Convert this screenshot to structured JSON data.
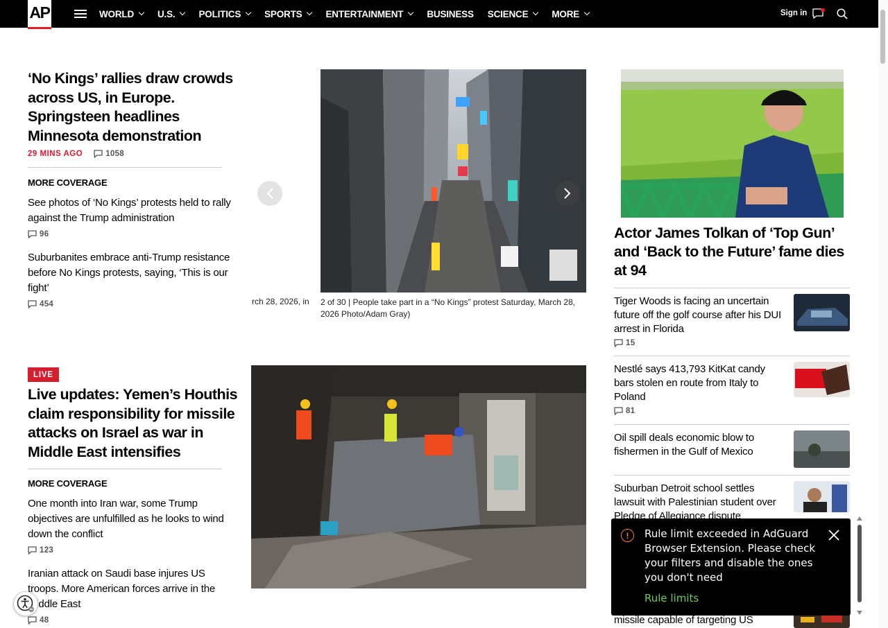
{
  "nav": {
    "logo": "AP",
    "items": [
      "WORLD",
      "U.S.",
      "POLITICS",
      "SPORTS",
      "ENTERTAINMENT",
      "BUSINESS",
      "SCIENCE",
      "MORE"
    ],
    "has_chevron": [
      true,
      true,
      true,
      true,
      true,
      false,
      true,
      true
    ],
    "signin": "Sign in",
    "accent": "#e41d24"
  },
  "lead": {
    "title": "‘No Kings’ rallies draw crowds across US, in Europe. Springsteen headlines Minnesota demonstration",
    "time": "29 MINS AGO",
    "comments": "1058",
    "more_coverage": "MORE COVERAGE",
    "links": [
      {
        "text": "See photos of ‘No Kings’ protests held to rally against the Trump administration",
        "comments": "96"
      },
      {
        "text": "Suburbanites embrace anti-Trump resistance before No Kings protests, saying, ‘This is our fight’",
        "comments": "454"
      }
    ]
  },
  "carousel": {
    "ghost_caption": "rch 28, 2026, in",
    "caption": "2 of 30 |  People take part in a “No Kings” protest Saturday, March 28, 2026 Photo/Adam Gray)"
  },
  "live": {
    "badge": "LIVE",
    "title": "Live updates: Yemen’s Houthis claim responsibility for missile attacks on Israel as war in Middle East intensifies",
    "more_coverage": "MORE COVERAGE",
    "links": [
      {
        "text": "One month into Iran war, some Trump objectives are unfulfilled as he looks to wind down the conflict",
        "comments": "123"
      },
      {
        "text": "Iranian attack on Saudi base injures US troops. More American forces arrive in the Middle East",
        "comments": "48"
      }
    ]
  },
  "right": {
    "title": "Actor James Tolkan of ‘Top Gun’ and ‘Back to the Future’ fame dies at 94",
    "stories": [
      {
        "text": "Tiger Woods is facing an uncertain future off the golf course after his DUI arrest in Florida",
        "comments": "15"
      },
      {
        "text": "Nestlé says 413,793 KitKat candy bars stolen en route from Italy to Poland",
        "comments": "81"
      },
      {
        "text": "Oil spill deals economic blow to fishermen in the Gulf of Mexico"
      },
      {
        "text": "Suburban Detroit school settles lawsuit with Palestinian student over Pledge of Allegiance dispute"
      },
      {
        "text": "missile capable of targeting US"
      }
    ]
  },
  "toast": {
    "message": "Rule limit exceeded in AdGuard Browser Extension. Please check your filters and disable the ones you don't need",
    "link": "Rule limits",
    "icon": "warning-circle-icon",
    "link_color": "#6fcb5c"
  },
  "colors": {
    "live_red": "#d4202e",
    "time_red": "#e0182d"
  }
}
